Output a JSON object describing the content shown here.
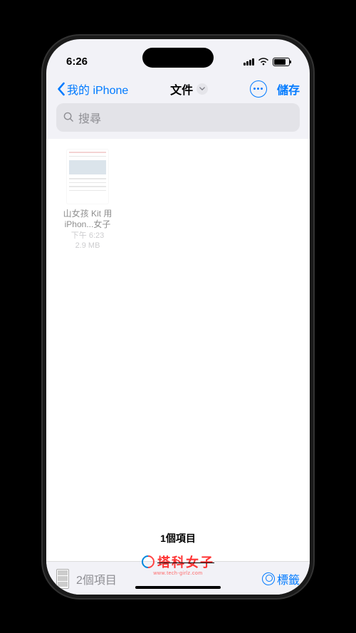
{
  "statusBar": {
    "time": "6:26"
  },
  "nav": {
    "backLabel": "我的 iPhone",
    "title": "文件",
    "saveLabel": "儲存"
  },
  "search": {
    "placeholder": "搜尋"
  },
  "files": [
    {
      "name1": "山女孩 Kit 用",
      "name2": "iPhon...女子",
      "time": "下午 6:23",
      "size": "2.9 MB"
    }
  ],
  "summary": {
    "countText": "1個項目"
  },
  "bottomBar": {
    "countText": "2個項目",
    "tagLabel": "標籤"
  },
  "watermark": {
    "brand": "塔科女子",
    "url": "www.tech-girlz.com"
  }
}
